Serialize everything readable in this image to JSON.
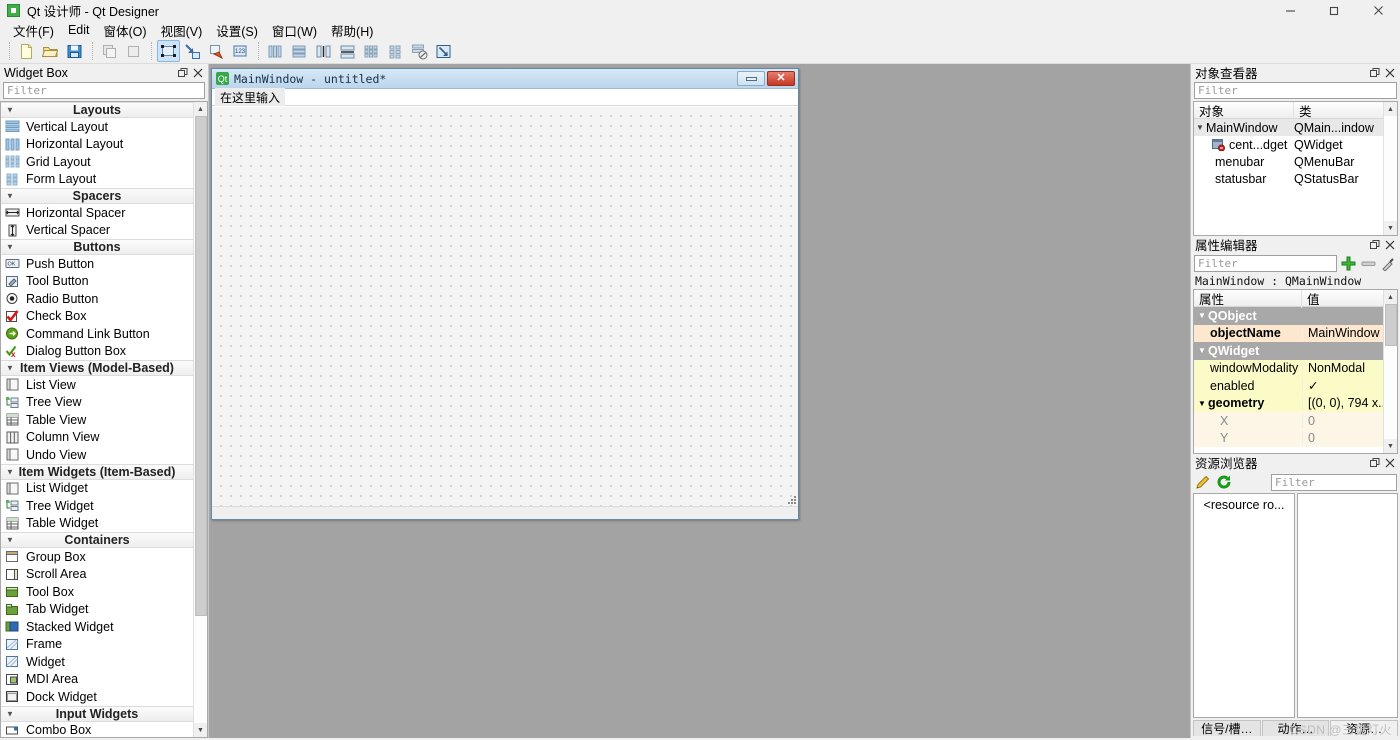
{
  "window": {
    "title": "Qt 设计师 - Qt Designer",
    "app_icon": "qt-logo-icon",
    "controls": {
      "minimize": "minimize-icon",
      "maximize": "maximize-icon",
      "close": "close-icon"
    }
  },
  "menubar": [
    {
      "label": "文件(F)"
    },
    {
      "label": "Edit"
    },
    {
      "label": "窗体(O)"
    },
    {
      "label": "视图(V)"
    },
    {
      "label": "设置(S)"
    },
    {
      "label": "窗口(W)"
    },
    {
      "label": "帮助(H)"
    }
  ],
  "toolbar": {
    "groups": [
      {
        "items": [
          {
            "name": "new-form-icon",
            "active": false
          },
          {
            "name": "open-form-icon",
            "active": false
          },
          {
            "name": "save-form-icon",
            "active": false
          }
        ]
      },
      {
        "items": [
          {
            "name": "undo-icon",
            "active": false
          },
          {
            "name": "redo-icon",
            "active": false
          }
        ]
      },
      {
        "items": [
          {
            "name": "edit-widgets-icon",
            "active": true
          },
          {
            "name": "edit-signals-slots-icon",
            "active": false
          },
          {
            "name": "edit-buddies-icon",
            "active": false
          },
          {
            "name": "edit-tab-order-icon",
            "active": false
          }
        ]
      },
      {
        "items": [
          {
            "name": "layout-horizontally-icon",
            "active": false
          },
          {
            "name": "layout-vertically-icon",
            "active": false
          },
          {
            "name": "layout-horizontal-splitter-icon",
            "active": false
          },
          {
            "name": "layout-vertical-splitter-icon",
            "active": false
          },
          {
            "name": "layout-grid-icon",
            "active": false
          },
          {
            "name": "layout-form-icon",
            "active": false
          },
          {
            "name": "break-layout-icon",
            "active": false
          },
          {
            "name": "adjust-size-icon",
            "active": false
          }
        ]
      }
    ]
  },
  "widget_box": {
    "title": "Widget Box",
    "title_buttons": [
      {
        "name": "float-icon"
      },
      {
        "name": "close-icon"
      }
    ],
    "filter_placeholder": "Filter",
    "categories": [
      {
        "label": "Layouts",
        "items": [
          {
            "label": "Vertical Layout",
            "icon": "vertical-layout-icon"
          },
          {
            "label": "Horizontal Layout",
            "icon": "horizontal-layout-icon"
          },
          {
            "label": "Grid Layout",
            "icon": "grid-layout-icon"
          },
          {
            "label": "Form Layout",
            "icon": "form-layout-icon"
          }
        ]
      },
      {
        "label": "Spacers",
        "items": [
          {
            "label": "Horizontal Spacer",
            "icon": "horizontal-spacer-icon"
          },
          {
            "label": "Vertical Spacer",
            "icon": "vertical-spacer-icon"
          }
        ]
      },
      {
        "label": "Buttons",
        "items": [
          {
            "label": "Push Button",
            "icon": "push-button-icon"
          },
          {
            "label": "Tool Button",
            "icon": "tool-button-icon"
          },
          {
            "label": "Radio Button",
            "icon": "radio-button-icon"
          },
          {
            "label": "Check Box",
            "icon": "check-box-icon"
          },
          {
            "label": "Command Link Button",
            "icon": "command-link-button-icon"
          },
          {
            "label": "Dialog Button Box",
            "icon": "dialog-button-box-icon"
          }
        ]
      },
      {
        "label": "Item Views (Model-Based)",
        "items": [
          {
            "label": "List View",
            "icon": "list-view-icon"
          },
          {
            "label": "Tree View",
            "icon": "tree-view-icon"
          },
          {
            "label": "Table View",
            "icon": "table-view-icon"
          },
          {
            "label": "Column View",
            "icon": "column-view-icon"
          },
          {
            "label": "Undo View",
            "icon": "undo-view-icon"
          }
        ]
      },
      {
        "label": "Item Widgets (Item-Based)",
        "items": [
          {
            "label": "List Widget",
            "icon": "list-widget-icon"
          },
          {
            "label": "Tree Widget",
            "icon": "tree-widget-icon"
          },
          {
            "label": "Table Widget",
            "icon": "table-widget-icon"
          }
        ]
      },
      {
        "label": "Containers",
        "items": [
          {
            "label": "Group Box",
            "icon": "group-box-icon"
          },
          {
            "label": "Scroll Area",
            "icon": "scroll-area-icon"
          },
          {
            "label": "Tool Box",
            "icon": "tool-box-icon"
          },
          {
            "label": "Tab Widget",
            "icon": "tab-widget-icon"
          },
          {
            "label": "Stacked Widget",
            "icon": "stacked-widget-icon"
          },
          {
            "label": "Frame",
            "icon": "frame-icon"
          },
          {
            "label": "Widget",
            "icon": "widget-icon"
          },
          {
            "label": "MDI Area",
            "icon": "mdi-area-icon"
          },
          {
            "label": "Dock Widget",
            "icon": "dock-widget-icon"
          }
        ]
      },
      {
        "label": "Input Widgets",
        "items": [
          {
            "label": "Combo Box",
            "icon": "combo-box-icon"
          }
        ]
      }
    ]
  },
  "form_window": {
    "icon": "qt-form-icon",
    "caption": "MainWindow - untitled*",
    "menu_placeholder": "在这里输入",
    "buttons": {
      "minimize": "minimize-icon",
      "close": "close-icon"
    }
  },
  "object_inspector": {
    "title": "对象查看器",
    "title_buttons": [
      {
        "name": "float-icon"
      },
      {
        "name": "close-icon"
      }
    ],
    "filter_placeholder": "Filter",
    "columns": [
      "对象",
      "类"
    ],
    "rows": [
      {
        "name": "MainWindow",
        "class": "QMain...indow",
        "depth": 0,
        "expandable": true,
        "icon": null
      },
      {
        "name": "cent...dget",
        "class": "QWidget",
        "depth": 1,
        "expandable": false,
        "icon": "central-widget-icon"
      },
      {
        "name": "menubar",
        "class": "QMenuBar",
        "depth": 1,
        "expandable": false,
        "icon": null
      },
      {
        "name": "statusbar",
        "class": "QStatusBar",
        "depth": 1,
        "expandable": false,
        "icon": null
      }
    ]
  },
  "property_editor": {
    "title": "属性编辑器",
    "title_buttons": [
      {
        "name": "float-icon"
      },
      {
        "name": "close-icon"
      }
    ],
    "filter_placeholder": "Filter",
    "tool_icons": [
      {
        "name": "add-property-icon"
      },
      {
        "name": "remove-property-icon"
      },
      {
        "name": "configure-icon"
      }
    ],
    "object_line": "MainWindow : QMainWindow",
    "columns": [
      "属性",
      "值"
    ],
    "rows": [
      {
        "kind": "group",
        "name": "QObject",
        "value": ""
      },
      {
        "kind": "obj",
        "name": "objectName",
        "value": "MainWindow"
      },
      {
        "kind": "group",
        "name": "QWidget",
        "value": ""
      },
      {
        "kind": "yellow",
        "name": "windowModality",
        "value": "NonModal"
      },
      {
        "kind": "yellow",
        "name": "enabled",
        "value": "✓"
      },
      {
        "kind": "yellow",
        "name": "geometry",
        "value": "[(0, 0), 794 x...",
        "bold": true,
        "expandable": true
      },
      {
        "kind": "sub",
        "name": "X",
        "value": "0"
      },
      {
        "kind": "sub",
        "name": "Y",
        "value": "0"
      }
    ]
  },
  "resource_browser": {
    "title": "资源浏览器",
    "title_buttons": [
      {
        "name": "float-icon"
      },
      {
        "name": "close-icon"
      }
    ],
    "tool_icons": [
      {
        "name": "edit-resources-icon"
      },
      {
        "name": "reload-icon"
      }
    ],
    "filter_placeholder": "Filter",
    "root_item": "<resource ro..."
  },
  "bottom_tabs": [
    {
      "label": "信号/槽…",
      "active": false
    },
    {
      "label": "动作…",
      "active": false
    },
    {
      "label": "资源…",
      "active": true
    }
  ],
  "watermark": "CSDN @三更灯火",
  "colors": {
    "chrome": "#f0f0f0",
    "canvas": "#a3a3a3",
    "accent": "#cde3f7",
    "form_title": "#bcd6ec",
    "group_row": "#a8a8a8",
    "obj_row": "#fde8cf",
    "yellow_row": "#fbfbc8"
  }
}
